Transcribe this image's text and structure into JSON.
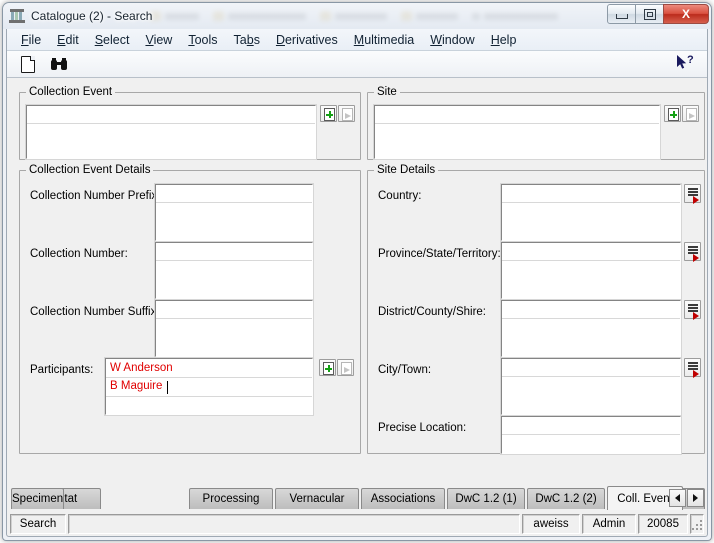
{
  "window": {
    "title": "Catalogue (2) - Search",
    "app_icon": "specimen-case-icon",
    "buttons": {
      "minimize": "minimize-button",
      "restore": "restore-button",
      "close_label": "X"
    }
  },
  "menubar": [
    {
      "label": "File",
      "accel": "F"
    },
    {
      "label": "Edit",
      "accel": "E"
    },
    {
      "label": "Select",
      "accel": "S"
    },
    {
      "label": "View",
      "accel": "V"
    },
    {
      "label": "Tools",
      "accel": "T"
    },
    {
      "label": "Tabs",
      "accel": "b"
    },
    {
      "label": "Derivatives",
      "accel": "D"
    },
    {
      "label": "Multimedia",
      "accel": "M"
    },
    {
      "label": "Window",
      "accel": "W"
    },
    {
      "label": "Help",
      "accel": "H"
    }
  ],
  "toolbar": {
    "new_record": "new-document-icon",
    "find": "binoculars-icon",
    "whats_this": "help-pointer-icon"
  },
  "groups": {
    "collection_event": {
      "legend": "Collection Event",
      "value": "",
      "add_button": "add-icon",
      "goto_button": "goto-icon"
    },
    "site": {
      "legend": "Site",
      "value": "",
      "add_button": "add-icon",
      "goto_button": "goto-icon"
    },
    "collection_event_details": {
      "legend": "Collection Event Details",
      "fields": [
        {
          "label": "Collection Number Prefix:",
          "values": [],
          "has_buttons": false
        },
        {
          "label": "Collection Number:",
          "values": [],
          "has_buttons": false
        },
        {
          "label": "Collection Number Suffix:",
          "values": [],
          "has_buttons": false
        },
        {
          "label": "Participants:",
          "values": [
            "W Anderson",
            "B Maguire"
          ],
          "has_buttons": true,
          "caret_after": "B Maguire"
        }
      ]
    },
    "site_details": {
      "legend": "Site Details",
      "fields": [
        {
          "label": "Country:",
          "values": [],
          "has_lookup": true
        },
        {
          "label": "Province/State/Territory:",
          "values": [],
          "has_lookup": true
        },
        {
          "label": "District/County/Shire:",
          "values": [],
          "has_lookup": true
        },
        {
          "label": "City/Town:",
          "values": [],
          "has_lookup": true
        },
        {
          "label": "Precise Location:",
          "values": [],
          "has_lookup": false
        }
      ]
    }
  },
  "tabs": {
    "items": [
      {
        "label": "Habitat",
        "active": false
      },
      {
        "label": "Specimen",
        "active": false
      },
      {
        "label": "Processing",
        "active": false
      },
      {
        "label": "Vernacular",
        "active": false
      },
      {
        "label": "Associations",
        "active": false
      },
      {
        "label": "DwC 1.2 (1)",
        "active": false
      },
      {
        "label": "DwC 1.2 (2)",
        "active": false
      },
      {
        "label": "Coll. Event",
        "active": true
      }
    ],
    "scroll_left": "scroll-left-icon",
    "scroll_right": "scroll-right-icon"
  },
  "statusbar": {
    "mode": "Search",
    "message": "",
    "user": "aweiss",
    "role": "Admin",
    "record_id": "20085"
  },
  "colors": {
    "entry_text": "#e00000",
    "window_chrome": "#f0f0f0",
    "close_button": "#d9503f"
  }
}
